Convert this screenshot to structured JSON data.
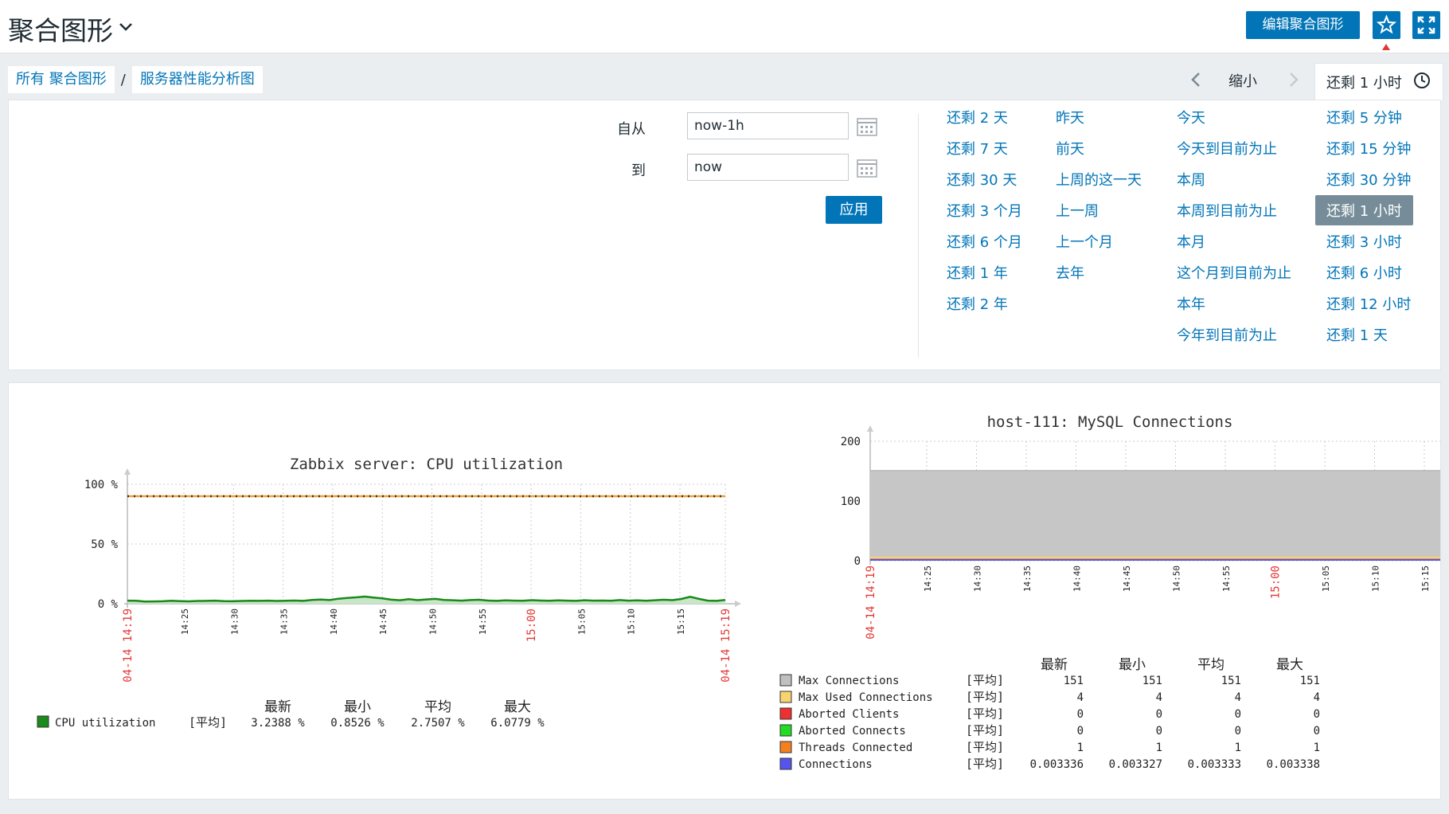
{
  "header": {
    "title": "聚合图形",
    "edit_button": "编辑聚合图形"
  },
  "breadcrumb": {
    "items": [
      "所有 聚合图形",
      "服务器性能分析图"
    ],
    "separator": "/"
  },
  "timeline": {
    "zoom_out": "缩小",
    "current_range": "还剩 1 小时"
  },
  "filter": {
    "from_label": "自从",
    "from_value": "now-1h",
    "to_label": "到",
    "to_value": "now",
    "apply_button": "应用",
    "quick_ranges": [
      [
        "还剩 2 天",
        "还剩 7 天",
        "还剩 30 天",
        "还剩 3 个月",
        "还剩 6 个月",
        "还剩 1 年",
        "还剩 2 年"
      ],
      [
        "昨天",
        "前天",
        "上周的这一天",
        "上一周",
        "上一个月",
        "去年"
      ],
      [
        "今天",
        "今天到目前为止",
        "本周",
        "本周到目前为止",
        "本月",
        "这个月到目前为止",
        "本年",
        "今年到目前为止"
      ],
      [
        "还剩 5 分钟",
        "还剩 15 分钟",
        "还剩 30 分钟",
        "还剩 1 小时",
        "还剩 3 小时",
        "还剩 6 小时",
        "还剩 12 小时",
        "还剩 1 天"
      ]
    ],
    "active_range": "还剩 1 小时"
  },
  "colors": {
    "accent": "#0275b8",
    "active_bg": "#768d99",
    "red_tick": "#e33734",
    "cpu_line": "#1a8a1a",
    "trigger_line": "#f0a030"
  },
  "chart_data": [
    {
      "type": "line",
      "title": "Zabbix server: CPU utilization",
      "y_ticks": [
        "100 %",
        "50 %",
        "0 %"
      ],
      "ylim": [
        0,
        100
      ],
      "x_ticks": [
        "04-14 14:19",
        "14:25",
        "14:30",
        "14:35",
        "14:40",
        "14:45",
        "14:50",
        "14:55",
        "15:00",
        "15:05",
        "15:10",
        "15:15",
        "04-14 15:19"
      ],
      "x_ticks_red": [
        "04-14 14:19",
        "15:00",
        "04-14 15:19"
      ],
      "trigger_value": 90,
      "series": [
        {
          "name": "CPU utilization",
          "color": "#1a8a1a",
          "function": "[平均]",
          "latest": "3.2388 %",
          "min": "0.8526 %",
          "avg": "2.7507 %",
          "max": "6.0779 %",
          "values": [
            2.6,
            2.5,
            1.8,
            1.9,
            2.1,
            2.5,
            2.2,
            2.0,
            2.3,
            2.4,
            2.6,
            2.2,
            2.1,
            2.3,
            2.5,
            2.4,
            2.6,
            2.3,
            2.5,
            2.7,
            2.4,
            3.2,
            3.5,
            3.1,
            4.2,
            4.8,
            5.3,
            6.0,
            5.2,
            4.5,
            3.4,
            2.9,
            3.8,
            3.0,
            3.6,
            4.1,
            3.2,
            2.9,
            2.6,
            3.1,
            3.3,
            2.7,
            2.4,
            2.8,
            2.6,
            2.5,
            3.0,
            2.7,
            2.5,
            2.8,
            2.6,
            2.4,
            2.9,
            2.6,
            2.7,
            2.5,
            3.1,
            2.6,
            2.8,
            2.5,
            2.9,
            3.3,
            3.0,
            4.0,
            5.8,
            4.1,
            2.6,
            2.4,
            3.2
          ]
        }
      ],
      "legend_headers": [
        "最新",
        "最小",
        "平均",
        "最大"
      ]
    },
    {
      "type": "area",
      "title": "host-111: MySQL Connections",
      "y_ticks": [
        "200",
        "100",
        "0"
      ],
      "ylim": [
        0,
        200
      ],
      "x_ticks": [
        "04-14 14:19",
        "14:25",
        "14:30",
        "14:35",
        "14:40",
        "14:45",
        "14:50",
        "14:55",
        "15:00",
        "15:05",
        "15:10",
        "15:15"
      ],
      "x_ticks_red": [
        "04-14 14:19",
        "15:00"
      ],
      "legend_headers": [
        "最新",
        "最小",
        "平均",
        "最大"
      ],
      "series": [
        {
          "name": "Max Connections",
          "color": "#c0c0c0",
          "function": "[平均]",
          "latest": "151",
          "min": "151",
          "avg": "151",
          "max": "151",
          "value": 151
        },
        {
          "name": "Max Used Connections",
          "color": "#f8d470",
          "function": "[平均]",
          "latest": "4",
          "min": "4",
          "avg": "4",
          "max": "4",
          "value": 4
        },
        {
          "name": "Aborted Clients",
          "color": "#ee3030",
          "function": "[平均]",
          "latest": "0",
          "min": "0",
          "avg": "0",
          "max": "0",
          "value": 0
        },
        {
          "name": "Aborted Connects",
          "color": "#22dd22",
          "function": "[平均]",
          "latest": "0",
          "min": "0",
          "avg": "0",
          "max": "0",
          "value": 0
        },
        {
          "name": "Threads Connected",
          "color": "#f58020",
          "function": "[平均]",
          "latest": "1",
          "min": "1",
          "avg": "1",
          "max": "1",
          "value": 1
        },
        {
          "name": "Connections",
          "color": "#5555ee",
          "function": "[平均]",
          "latest": "0.003336",
          "min": "0.003327",
          "avg": "0.003333",
          "max": "0.003338",
          "value": 0.003333
        }
      ]
    }
  ]
}
